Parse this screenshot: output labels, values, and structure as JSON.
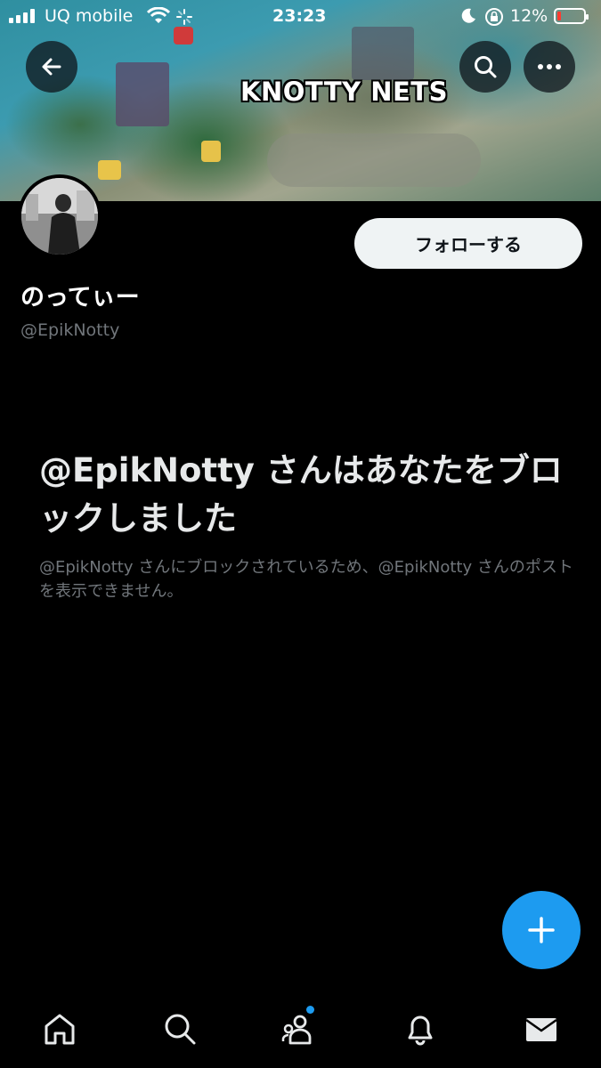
{
  "status_bar": {
    "carrier": "UQ mobile",
    "time": "23:23",
    "battery_percent": "12%"
  },
  "banner": {
    "title": "KNOTTY NETS"
  },
  "header": {
    "back_icon": "arrow-left-icon",
    "search_icon": "search-icon",
    "more_icon": "more-horizontal-icon"
  },
  "profile": {
    "display_name": "のってぃー",
    "handle": "@EpikNotty",
    "follow_label": "フォローする"
  },
  "blocked": {
    "title": "@EpikNotty さんはあなたをブロックしました",
    "description": "@EpikNotty さんにブロックされているため、@EpikNotty さんのポストを表示できません。"
  },
  "tabs": [
    {
      "name": "home",
      "icon": "home-icon"
    },
    {
      "name": "search",
      "icon": "search-icon"
    },
    {
      "name": "communities",
      "icon": "communities-icon",
      "has_badge": true
    },
    {
      "name": "notifications",
      "icon": "bell-icon"
    },
    {
      "name": "messages",
      "icon": "mail-icon"
    }
  ],
  "colors": {
    "accent": "#1d9bf0",
    "background": "#000000",
    "secondary_text": "#71767b"
  }
}
